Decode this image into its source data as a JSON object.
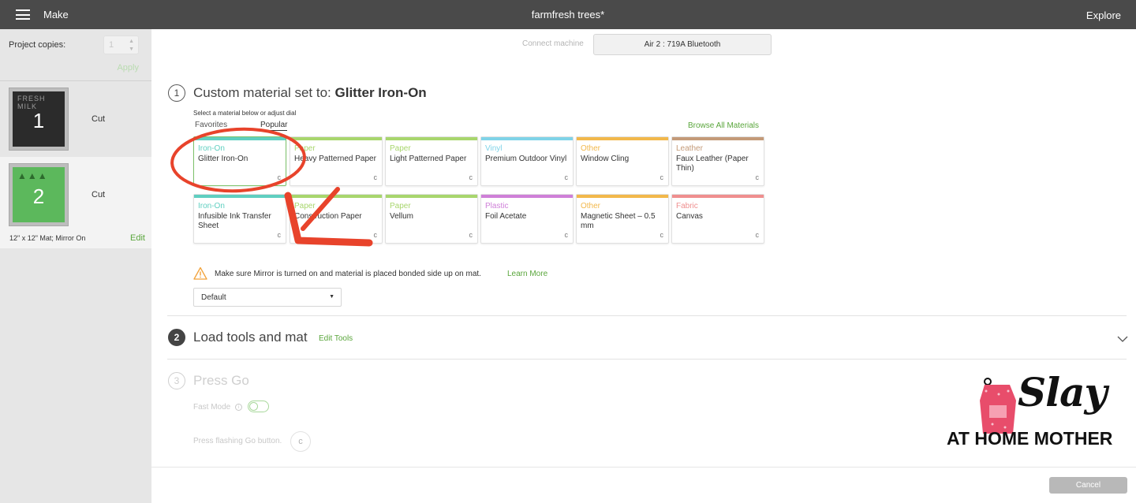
{
  "topbar": {
    "make_label": "Make",
    "doc_title": "farmfresh trees*",
    "explore_label": "Explore"
  },
  "sidebar": {
    "copies_label": "Project copies:",
    "copies_value": "1",
    "apply_label": "Apply",
    "mats": [
      {
        "number": "1",
        "action": "Cut",
        "deco": "FRESH MILK"
      },
      {
        "number": "2",
        "action": "Cut",
        "deco": "▲▲▲",
        "info": "12\" x 12\" Mat; Mirror On",
        "edit_label": "Edit"
      }
    ]
  },
  "connect": {
    "label": "Connect machine",
    "machine": "Air 2 : 719A Bluetooth"
  },
  "step1": {
    "number": "1",
    "title_prefix": "Custom material set to: ",
    "title_material": "Glitter Iron-On",
    "hint": "Select a material below or adjust dial",
    "tabs": [
      "Favorites",
      "Popular"
    ],
    "active_tab": "Popular",
    "browse_all": "Browse All Materials",
    "materials": [
      {
        "category": "Iron-On",
        "name": "Glitter Iron-On",
        "color": "#5fcfc0",
        "selected": true
      },
      {
        "category": "Paper",
        "name": "Heavy Patterned Paper",
        "color": "#a8d66d"
      },
      {
        "category": "Paper",
        "name": "Light Patterned Paper",
        "color": "#a8d66d"
      },
      {
        "category": "Vinyl",
        "name": "Premium Outdoor Vinyl",
        "color": "#7fd3e8"
      },
      {
        "category": "Other",
        "name": "Window Cling",
        "color": "#f2b84b"
      },
      {
        "category": "Leather",
        "name": "Faux Leather (Paper Thin)",
        "color": "#c49a78"
      },
      {
        "category": "Iron-On",
        "name": "Infusible Ink Transfer Sheet",
        "color": "#5fcfc0"
      },
      {
        "category": "Paper",
        "name": "Construction Paper",
        "color": "#a8d66d"
      },
      {
        "category": "Paper",
        "name": "Vellum",
        "color": "#a8d66d"
      },
      {
        "category": "Plastic",
        "name": "Foil Acetate",
        "color": "#cf7fd8"
      },
      {
        "category": "Other",
        "name": "Magnetic Sheet – 0.5 mm",
        "color": "#f2b84b"
      },
      {
        "category": "Fabric",
        "name": "Canvas",
        "color": "#ef8f8f"
      }
    ],
    "warning": "Make sure Mirror is turned on and material is placed bonded side up on mat.",
    "learn_more": "Learn More",
    "pressure": "Default"
  },
  "step2": {
    "number": "2",
    "title": "Load tools and mat",
    "edit_tools": "Edit Tools"
  },
  "step3": {
    "number": "3",
    "title": "Press Go",
    "fast_mode": "Fast Mode",
    "press_go": "Press flashing Go button."
  },
  "footer": {
    "cancel": "Cancel"
  },
  "watermark": {
    "script": "Slay",
    "sub": "AT HOME MOTHER"
  },
  "colors": {
    "accent_green": "#5aa63c",
    "annotation_red": "#e8432b",
    "topbar": "#4a4a4a"
  }
}
